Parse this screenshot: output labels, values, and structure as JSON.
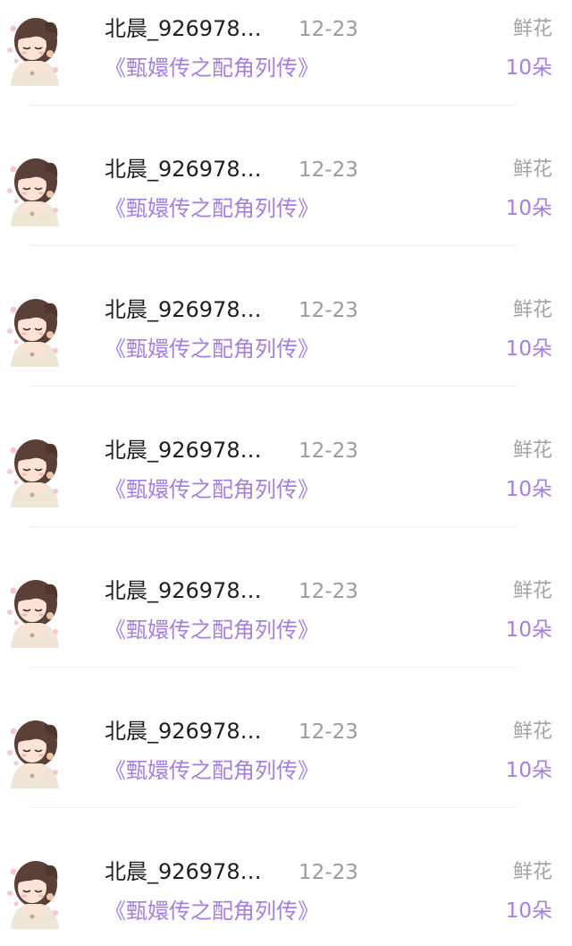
{
  "items": [
    {
      "user": "北晨_926978…",
      "date": "12-23",
      "title": "《甄嬛传之配角列传》",
      "gift": "鲜花",
      "count": "10朵",
      "avatar": "cartoon-girl-avatar"
    },
    {
      "user": "北晨_926978…",
      "date": "12-23",
      "title": "《甄嬛传之配角列传》",
      "gift": "鲜花",
      "count": "10朵",
      "avatar": "cartoon-girl-avatar"
    },
    {
      "user": "北晨_926978…",
      "date": "12-23",
      "title": "《甄嬛传之配角列传》",
      "gift": "鲜花",
      "count": "10朵",
      "avatar": "cartoon-girl-avatar"
    },
    {
      "user": "北晨_926978…",
      "date": "12-23",
      "title": "《甄嬛传之配角列传》",
      "gift": "鲜花",
      "count": "10朵",
      "avatar": "cartoon-girl-avatar"
    },
    {
      "user": "北晨_926978…",
      "date": "12-23",
      "title": "《甄嬛传之配角列传》",
      "gift": "鲜花",
      "count": "10朵",
      "avatar": "cartoon-girl-avatar"
    },
    {
      "user": "北晨_926978…",
      "date": "12-23",
      "title": "《甄嬛传之配角列传》",
      "gift": "鲜花",
      "count": "10朵",
      "avatar": "cartoon-girl-avatar"
    },
    {
      "user": "北晨_926978…",
      "date": "12-23",
      "title": "《甄嬛传之配角列传》",
      "gift": "鲜花",
      "count": "10朵",
      "avatar": "cartoon-girl-avatar"
    }
  ],
  "colors": {
    "accent": "#a57fe0",
    "name_text": "#1f1f1f",
    "muted_text": "#9b9b9b",
    "divider": "#efefef"
  }
}
